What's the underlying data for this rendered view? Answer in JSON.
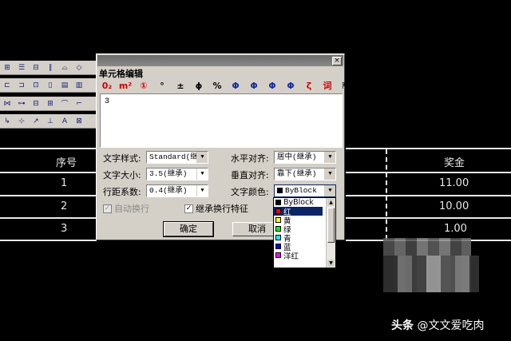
{
  "dialog": {
    "title": "单元格编辑",
    "close_label": "×",
    "symbols": [
      "0₂",
      "m²",
      "①",
      "°",
      "±",
      "ϕ",
      "%",
      "Φ",
      "Φ",
      "Φ",
      "Φ",
      "ζ",
      "词",
      "⇱"
    ],
    "editor_text": "3",
    "text_style_label": "文字样式:",
    "text_style_value": "Standard(继",
    "text_size_label": "文字大小:",
    "text_size_value": "3.5(继承)",
    "line_spacing_label": "行距系数:",
    "line_spacing_value": "0.4(继承)",
    "h_align_label": "水平对齐:",
    "h_align_value": "居中(继承)",
    "v_align_label": "垂直对齐:",
    "v_align_value": "靠下(继承)",
    "text_color_label": "文字颜色:",
    "text_color_value": "ByBlock",
    "auto_wrap_label": "自动换行",
    "auto_wrap_checked": true,
    "auto_wrap_enabled": false,
    "inherit_wrap_label": "继承换行特征",
    "inherit_wrap_checked": true,
    "ok_label": "确定",
    "cancel_label": "取消"
  },
  "color_dropdown": {
    "items": [
      {
        "label": "ByBlock",
        "color": "#000000"
      },
      {
        "label": "红",
        "color": "#ff0000",
        "selected": true
      },
      {
        "label": "黄",
        "color": "#ffff00"
      },
      {
        "label": "绿",
        "color": "#00ff00"
      },
      {
        "label": "青",
        "color": "#00ffff"
      },
      {
        "label": "蓝",
        "color": "#0000ff"
      },
      {
        "label": "洋红",
        "color": "#ff00ff"
      }
    ]
  },
  "table": {
    "header_left": "序号",
    "header_right": "奖金",
    "rows": [
      {
        "index": "1",
        "amount": "11.00"
      },
      {
        "index": "2",
        "amount": "10.00"
      },
      {
        "index": "3",
        "amount": "1.00"
      }
    ]
  },
  "watermark": {
    "brand": "头条",
    "handle": "@文文爱吃肉"
  }
}
